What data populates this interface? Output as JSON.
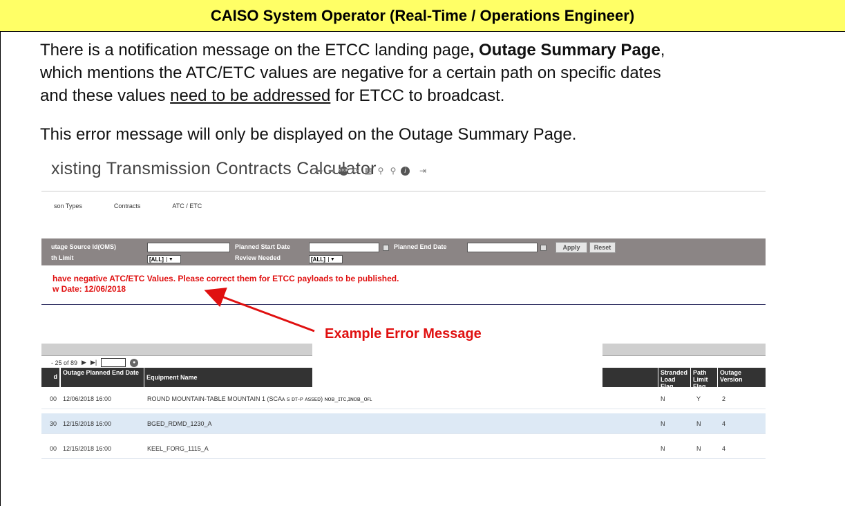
{
  "header": {
    "title": "CAISO System Operator (Real-Time / Operations Engineer)"
  },
  "description": {
    "line1_pre": "There is a notification message on the ETCC landing page",
    "line1_bold": ", Outage Summary Page",
    "line1_post": ",",
    "line2": "which mentions the ATC/ETC values are negative for a certain path on specific dates",
    "line3_pre": "and these values ",
    "line3_underline": "need to be addressed",
    "line3_post": " for ETCC to broadcast.",
    "note": "This error message will only be displayed on the Outage Summary Page."
  },
  "app": {
    "title": "xisting Transmission Contracts Calculator",
    "toolbar_icons": [
      "back-arrow-icon",
      "forward-arrow-icon",
      "stop-icon",
      "refresh-icon",
      "excel-export-icon",
      "zoom-in-icon",
      "zoom-out-icon",
      "help-icon",
      "logout-icon"
    ],
    "menu": [
      "son Types",
      "Contracts",
      "ATC / ETC"
    ],
    "filters": {
      "outage_source_label": "utage Source Id(OMS)",
      "path_limit_label": "th Limit",
      "path_limit_value": "[ALL]",
      "planned_start_label": "Planned Start Date",
      "review_needed_label": "Review Needed",
      "review_needed_value": "[ALL]",
      "planned_end_label": "Planned End Date",
      "apply": "Apply",
      "reset": "Reset"
    },
    "error_line1": "have negative ATC/ETC Values. Please correct them for ETCC payloads to be published.",
    "error_line2": "w Date: 12/06/2018",
    "callout": "Example Error Message",
    "pager": {
      "text": "- 25  of  89",
      "next": "▶",
      "last": "▶|"
    },
    "columns": {
      "c0": "d",
      "c1": "Outage Planned End Date",
      "c2": "Equipment Name",
      "c3": "Stranded Load Flag",
      "c4": "Path Limit Flag",
      "c5": "Outage Version"
    },
    "rows": [
      {
        "c0": "00",
        "end": "12/06/2018 16:00",
        "equip": "ROUND MOUNTAIN-TABLE MOUNTAIN 1 (SCAᴀ s ᴅᴛ-ᴘ ᴀssᴇᴅ)   ɴᴏʙ_ɪᴛᴄ,ɪɴᴏʙ_ᴏғʟ",
        "stranded": "N",
        "path": "Y",
        "version": "2"
      },
      {
        "c0": "30",
        "end": "12/15/2018 16:00",
        "equip": "BGED_RDMD_1230_A",
        "stranded": "N",
        "path": "N",
        "version": "4"
      },
      {
        "c0": "00",
        "end": "12/15/2018 16:00",
        "equip": "KEEL_FORG_1115_A",
        "stranded": "N",
        "path": "N",
        "version": "4"
      }
    ]
  },
  "colors": {
    "header_bg": "#ffff66",
    "error": "#e01010",
    "filter_bg": "#8b8585",
    "alt_row": "#dde9f5"
  }
}
